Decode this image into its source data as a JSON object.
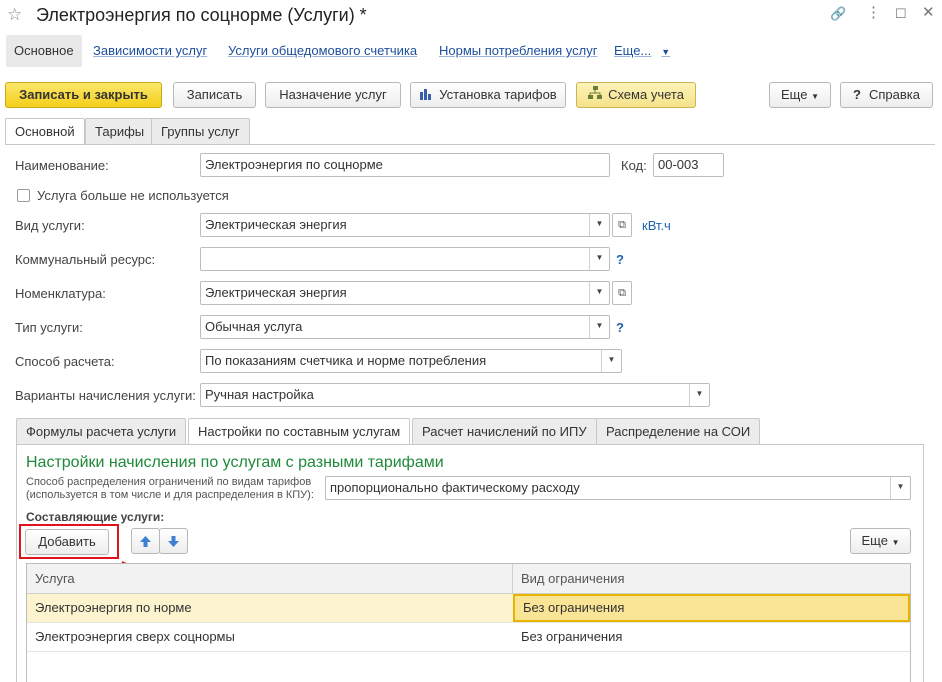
{
  "window": {
    "title": "Электроэнергия по соцнорме (Услуги) *"
  },
  "nav": {
    "items": [
      {
        "label": "Основное"
      },
      {
        "label": "Зависимости услуг"
      },
      {
        "label": "Услуги общедомового счетчика"
      },
      {
        "label": "Нормы потребления услуг"
      },
      {
        "label": "Еще..."
      }
    ]
  },
  "toolbar": {
    "save_close": "Записать и закрыть",
    "save": "Записать",
    "assign": "Назначение услуг",
    "tariffs": "Установка тарифов",
    "scheme": "Схема учета",
    "more": "Еще",
    "help": "Справка"
  },
  "tabs": [
    "Основной",
    "Тарифы",
    "Группы услуг"
  ],
  "form": {
    "name_label": "Наименование:",
    "name_value": "Электроэнергия по соцнорме",
    "code_label": "Код:",
    "code_value": "00-003",
    "unused_label": "Услуга больше не используется",
    "service_type_label": "Вид услуги:",
    "service_type_value": "Электрическая энергия",
    "unit": "кВт.ч",
    "resource_label": "Коммунальный ресурс:",
    "resource_value": "",
    "nomenclature_label": "Номенклатура:",
    "nomenclature_value": "Электрическая энергия",
    "kind_label": "Тип услуги:",
    "kind_value": "Обычная услуга",
    "calc_label": "Способ расчета:",
    "calc_value": "По показаниям счетчика и норме потребления",
    "variants_label": "Варианты начисления услуги:",
    "variants_value": "Ручная настройка",
    "question": "?"
  },
  "subtabs": [
    "Формулы расчета услуги",
    "Настройки по составным услугам",
    "Расчет начислений по ИПУ",
    "Распределение на СОИ"
  ],
  "panel": {
    "title": "Настройки начисления по услугам с разными тарифами",
    "distribution_label_1": "Способ распределения ограничений по видам тарифов",
    "distribution_label_2": "(используется в том числе и для распределения в КПУ):",
    "distribution_value": "пропорционально фактическому расходу",
    "components_label": "Составляющие услуги:",
    "add_button": "Добавить",
    "more_button": "Еще"
  },
  "table": {
    "columns": [
      "Услуга",
      "Вид ограничения"
    ],
    "rows": [
      {
        "service": "Электроэнергия по норме",
        "limit": "Без ограничения"
      },
      {
        "service": "Электроэнергия сверх соцнормы",
        "limit": "Без ограничения"
      }
    ]
  },
  "colors": {
    "primary_button": "#f4cf1a",
    "group_title": "#1f8a3a",
    "highlight": "#e0141c",
    "selected_row": "#fcf3cf"
  }
}
